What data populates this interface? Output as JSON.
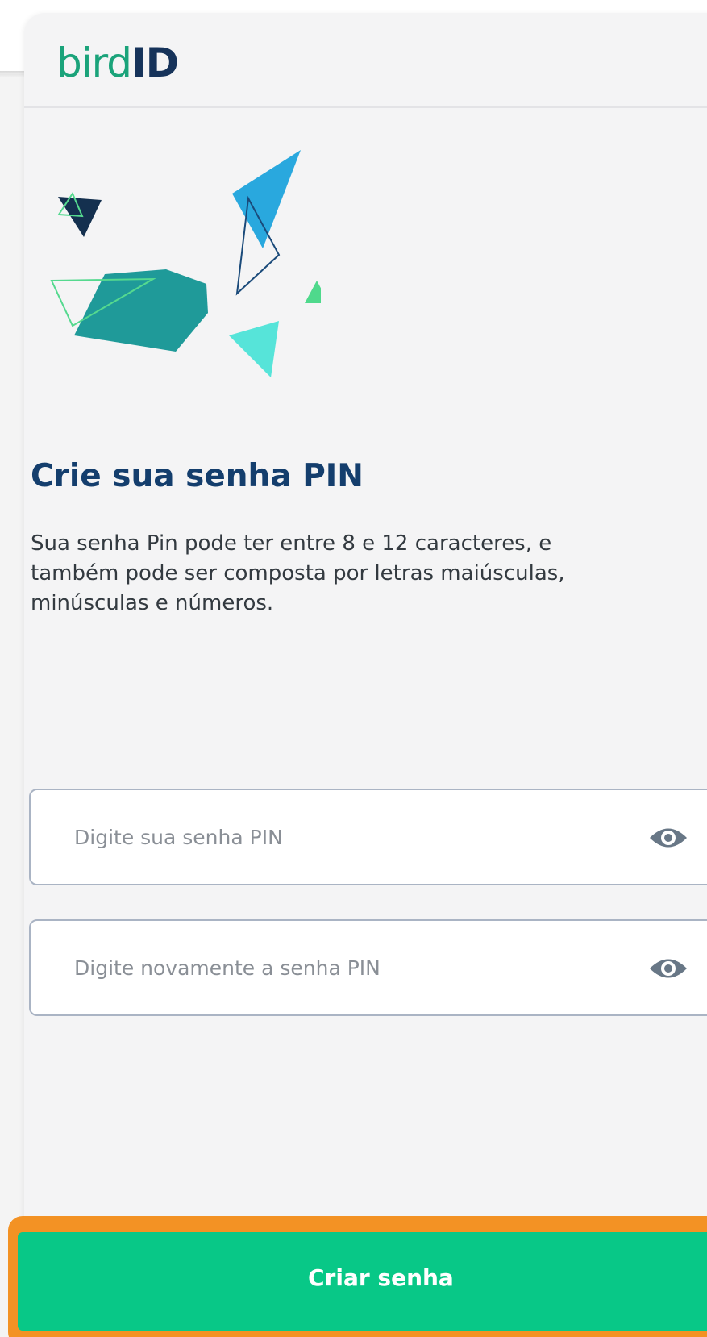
{
  "header": {
    "logo_light": "bird",
    "logo_bold": "ID"
  },
  "main": {
    "title": "Crie sua senha PIN",
    "description": "Sua senha Pin pode ter entre 8 e 12 caracteres, e também pode ser composta por letras maiúsculas, minúsculas e números."
  },
  "fields": {
    "pin": {
      "placeholder": "Digite sua senha PIN",
      "value": "",
      "icon": "eye-icon"
    },
    "pin_confirm": {
      "placeholder": "Digite novamente a senha PIN",
      "value": "",
      "icon": "eye-icon"
    }
  },
  "actions": {
    "submit_label": "Criar senha"
  },
  "colors": {
    "brand_green": "#1aa37a",
    "brand_navy": "#16335a",
    "button": "#08c887",
    "highlight": "#f39224"
  }
}
